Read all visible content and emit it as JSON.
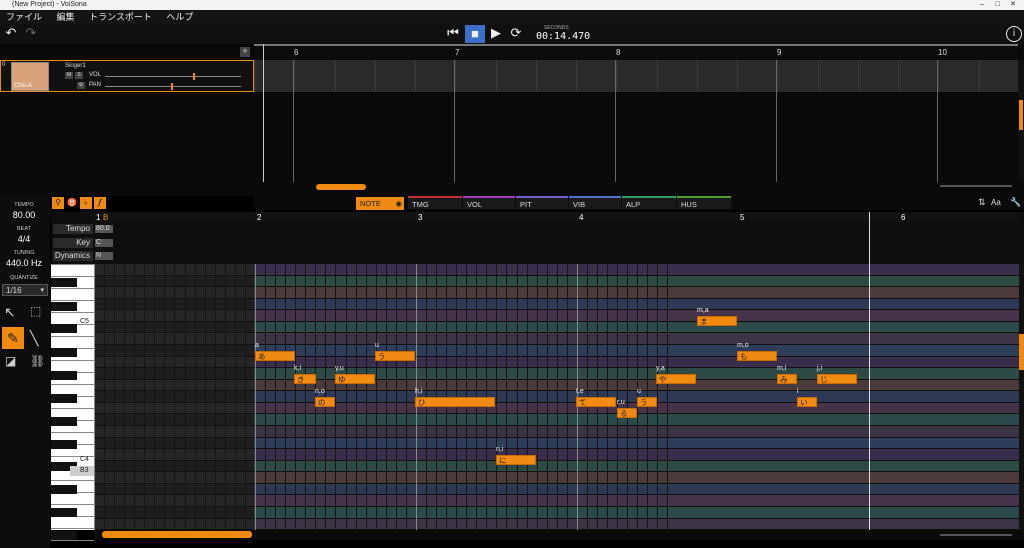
{
  "window": {
    "title": "(New Project) - VoiSona"
  },
  "menu": [
    "ファイル",
    "編集",
    "トランスポート",
    "ヘルプ"
  ],
  "transport": {
    "seconds_label": "SECONDS",
    "time": "00:14.470"
  },
  "track": {
    "index": "0",
    "name": "Singer1",
    "vol_label": "VOL",
    "pan_label": "PAN",
    "singer": "Chis-A"
  },
  "track_ruler": [
    "6",
    "7",
    "8",
    "9",
    "10"
  ],
  "left": {
    "tempo_label": "TEMPO",
    "tempo": "80.00",
    "beat_label": "BEAT",
    "beat": "4/4",
    "tuning_label": "TUNING",
    "tuning": "440.0 Hz",
    "quantize_label": "QUANTIZE",
    "quantize": "1/16"
  },
  "tabs": [
    "NOTE",
    "TMG",
    "VOL",
    "PIT",
    "VIB",
    "ALP",
    "HUS"
  ],
  "roll_ruler": [
    "1",
    "2",
    "3",
    "4",
    "5",
    "6"
  ],
  "roll_marker": "B",
  "header_rows": [
    {
      "label": "Tempo",
      "value": "80.0"
    },
    {
      "label": "Key",
      "value": "C"
    },
    {
      "label": "Dynamics",
      "value": "N"
    }
  ],
  "keys": {
    "c5": "C5",
    "c4": "C4",
    "b3": "B3"
  },
  "notes": [
    {
      "ph": "a",
      "ly": "あ"
    },
    {
      "ph": "k,i",
      "ly": "き"
    },
    {
      "ph": "n,o",
      "ly": "の"
    },
    {
      "ph": "y,u",
      "ly": "ゆ"
    },
    {
      "ph": "u",
      "ly": "う"
    },
    {
      "ph": "h,i",
      "ly": "ひ"
    },
    {
      "ph": "n,i",
      "ly": "に"
    },
    {
      "ph": "t,e",
      "ly": "て"
    },
    {
      "ph": "r,u",
      "ly": "る"
    },
    {
      "ph": "u",
      "ly": "う"
    },
    {
      "ph": "y,a",
      "ly": "や"
    },
    {
      "ph": "m,a",
      "ly": "ま"
    },
    {
      "ph": "m,o",
      "ly": "も"
    },
    {
      "ph": "m,i",
      "ly": "み"
    },
    {
      "ph": "i",
      "ly": "い"
    },
    {
      "ph": "j,i",
      "ly": "じ"
    }
  ],
  "colors": {
    "accent": "#f08a10",
    "tmg": "#c03030",
    "vol": "#a040c0",
    "pit": "#7060d0",
    "vib": "#5070d0",
    "alp": "#30a060",
    "hus": "#50a030"
  }
}
